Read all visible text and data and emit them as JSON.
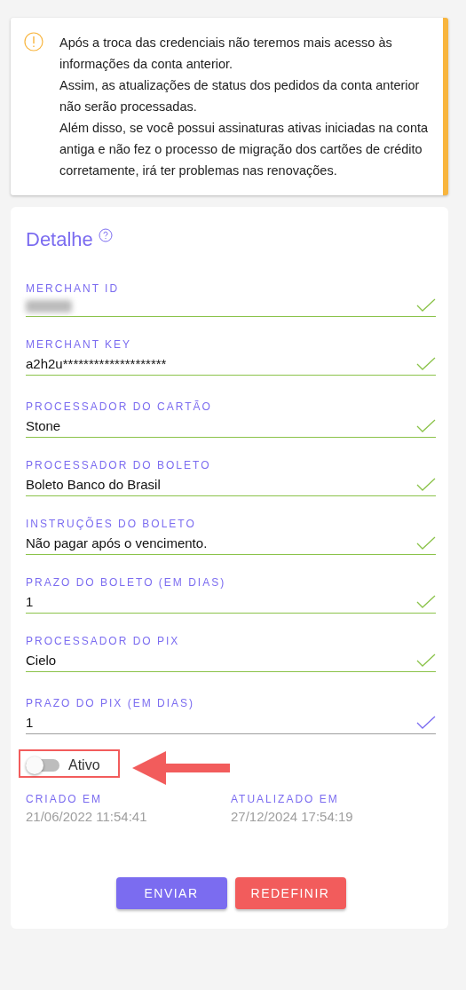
{
  "warning": {
    "paragraphs": [
      "Após a troca das credenciais não teremos mais acesso às informações da conta anterior.",
      "Assim, as atualizações de status dos pedidos da conta anterior não serão processadas.",
      "Além disso, se você possui assinaturas ativas iniciadas na conta antiga e não fez o processo de migração dos cartões de crédito corretamente, irá ter problemas nas renovações."
    ]
  },
  "detail": {
    "title": "Detalhe",
    "sections": [
      {
        "fields": [
          {
            "label": "MERCHANT ID",
            "kind": "redacted",
            "valid": true
          },
          {
            "label": "MERCHANT KEY",
            "kind": "text",
            "value": "a2h2u********************",
            "valid": true
          }
        ]
      },
      {
        "fields": [
          {
            "label": "PROCESSADOR DO CARTÃO",
            "kind": "text",
            "value": "Stone",
            "valid": true
          },
          {
            "label": "PROCESSADOR DO BOLETO",
            "kind": "text",
            "value": "Boleto Banco do Brasil",
            "valid": true
          },
          {
            "label": "INSTRUÇÕES DO BOLETO",
            "kind": "text",
            "value": "Não pagar após o vencimento.",
            "valid": true
          },
          {
            "label": "PRAZO DO BOLETO (EM DIAS)",
            "kind": "text",
            "value": "1",
            "valid": true
          },
          {
            "label": "PROCESSADOR DO PIX",
            "kind": "text",
            "value": "Cielo",
            "valid": true
          }
        ]
      },
      {
        "fields": [
          {
            "label": "PRAZO DO PIX (EM DIAS)",
            "kind": "text",
            "value": "1",
            "valid": false
          }
        ]
      }
    ]
  },
  "toggle": {
    "label": "Ativo",
    "on": false,
    "highlighted": true
  },
  "dates": [
    {
      "label": "CRIADO EM",
      "value": "21/06/2022 11:54:41"
    },
    {
      "label": "ATUALIZADO EM",
      "value": "27/12/2024 17:54:19"
    }
  ],
  "buttons": [
    {
      "label": "ENVIAR",
      "kind": "primary"
    },
    {
      "label": "REDEFINIR",
      "kind": "danger"
    }
  ]
}
